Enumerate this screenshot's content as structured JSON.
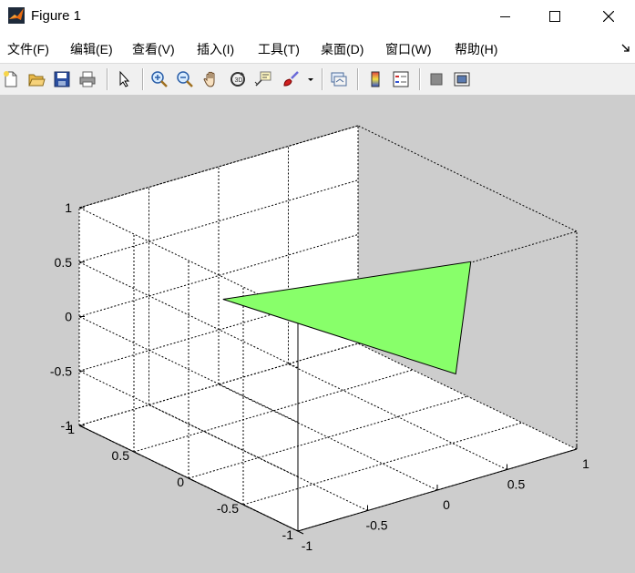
{
  "window": {
    "title": "Figure 1",
    "controls": [
      "minimize",
      "maximize",
      "close"
    ]
  },
  "menu": {
    "items": [
      {
        "label": "文件(F)"
      },
      {
        "label": "编辑(E)"
      },
      {
        "label": "查看(V)"
      },
      {
        "label": "插入(I)"
      },
      {
        "label": "工具(T)"
      },
      {
        "label": "桌面(D)"
      },
      {
        "label": "窗口(W)"
      },
      {
        "label": "帮助(H)"
      }
    ],
    "dock_icon": "dock-arrow-icon"
  },
  "toolbar": {
    "buttons": [
      "new-figure-icon",
      "open-file-icon",
      "save-icon",
      "print-icon",
      "edit-plot-arrow-icon",
      "zoom-in-icon",
      "zoom-out-icon",
      "pan-hand-icon",
      "rotate-3d-icon",
      "data-cursor-icon",
      "brush-icon",
      "brush-dropdown-icon",
      "link-plot-icon",
      "colorbar-icon",
      "legend-icon",
      "hide-plot-tools-icon",
      "show-plot-tools-icon"
    ]
  },
  "colors": {
    "figure_background": "#cdcdcd",
    "axes_background": "#ffffff",
    "patch_fill": "#88ff6a",
    "patch_edge": "#000000"
  },
  "chart_data": {
    "type": "patch3d",
    "title": "",
    "xlabel": "",
    "ylabel": "",
    "zlabel": "",
    "grid": true,
    "box": true,
    "view": "3-D default",
    "xlim": [
      -1,
      1
    ],
    "ylim": [
      -1,
      1
    ],
    "zlim": [
      -1,
      1
    ],
    "x_ticks": [
      "-1",
      "-0.5",
      "0",
      "0.5",
      "1"
    ],
    "y_ticks": [
      "-1",
      "-0.5",
      "0",
      "0.5",
      "1"
    ],
    "z_ticks": [
      "-1",
      "-0.5",
      "0",
      "0.5",
      "1"
    ],
    "series": [
      {
        "vertices": [
          {
            "x": -0.4,
            "y": 0.45,
            "z": 0.2
          },
          {
            "x": 0.75,
            "y": -0.35,
            "z": 0.5
          },
          {
            "x": 0.25,
            "y": -0.85,
            "z": -0.1
          }
        ],
        "color": "#88ff6a"
      }
    ]
  }
}
